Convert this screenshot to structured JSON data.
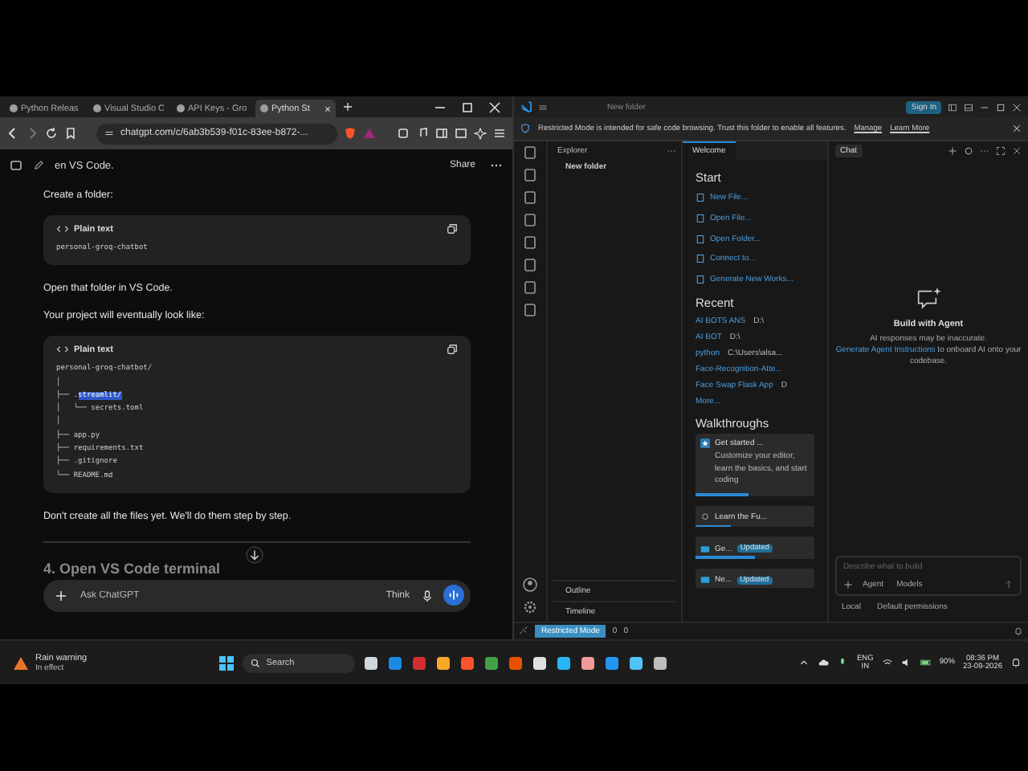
{
  "browser": {
    "tabs": [
      {
        "label": "Python Releas",
        "selected": false
      },
      {
        "label": "Visual Studio C",
        "selected": false
      },
      {
        "label": "API Keys - Gro",
        "selected": false
      },
      {
        "label": "Python St",
        "selected": true
      }
    ],
    "url": "chatgpt.com/c/6ab3b539-f01c-83ee-b872-...",
    "chat": {
      "top_text": "en VS Code.",
      "share": "Share",
      "paragraphs_a": [
        "Create a folder:"
      ],
      "code_blocks": [
        {
          "language": "Plain text",
          "lines": [
            [
              {
                "text": "personal-groq-chatbot",
                "selected": false
              }
            ]
          ]
        },
        {
          "language": "Plain text",
          "lines": [
            [
              {
                "text": "personal-groq-chatbot/",
                "selected": false
              }
            ],
            [
              {
                "text": "│",
                "selected": false
              }
            ],
            [
              {
                "text": "├── .",
                "selected": false
              },
              {
                "text": "streamlit/",
                "selected": true
              }
            ],
            [
              {
                "text": "│   └── secrets.toml",
                "selected": false
              }
            ],
            [
              {
                "text": "│",
                "selected": false
              }
            ],
            [
              {
                "text": "├── app.py",
                "selected": false
              }
            ],
            [
              {
                "text": "├── requirements.txt",
                "selected": false
              }
            ],
            [
              {
                "text": "├── .gitignore",
                "selected": false
              }
            ],
            [
              {
                "text": "└── README.md",
                "selected": false
              }
            ]
          ]
        }
      ],
      "paragraphs_b": [
        "Open that folder in VS Code.",
        "Your project will eventually look like:"
      ],
      "paragraph_c": "Don't create all the files yet. We'll do them step by step.",
      "heading": "4. Open VS Code terminal",
      "input_placeholder": "Ask ChatGPT",
      "think": "Think"
    }
  },
  "vscode": {
    "title": "New folder",
    "sign_in": "Sign In",
    "banner": {
      "text": "Restricted Mode is intended for safe code browsing. Trust this folder to enable all features.",
      "links": [
        "Manage",
        "Learn More"
      ]
    },
    "explorer": {
      "title": "Explorer",
      "folder": "New folder",
      "sections": [
        "Outline",
        "Timeline"
      ]
    },
    "welcome": {
      "tab": "Welcome",
      "start_title": "Start",
      "start": [
        "New File...",
        "Open File...",
        "Open Folder...",
        "Connect to...",
        "Generate New Works..."
      ],
      "recent_title": "Recent",
      "recent": [
        {
          "name": "AI BOTS ANS",
          "path": "D:\\"
        },
        {
          "name": "AI BOT",
          "path": "D:\\"
        },
        {
          "name": "python",
          "path": "C:\\Users\\alsa..."
        },
        {
          "name": "Face-Recognition-Atte..."
        },
        {
          "name": "Face Swap Flask App",
          "path": "D"
        }
      ],
      "more": "More...",
      "walkthroughs_title": "Walkthroughs",
      "walkthroughs": [
        {
          "kind": "card",
          "title": "Get started ...",
          "description": "Customize your editor, learn the basics, and start coding",
          "level": 0.45
        },
        {
          "kind": "item",
          "title": "Learn the Fu...",
          "level": 0.3
        },
        {
          "kind": "item",
          "title": "Ge...",
          "badge": "Updated",
          "level": 0.5
        },
        {
          "kind": "item",
          "title": "Ne...",
          "badge": "Updated"
        }
      ]
    },
    "chat": {
      "tab": "Chat",
      "title": "Build with Agent",
      "note": "AI responses may be inaccurate.",
      "link": "Generate Agent Instructions",
      "rest": " to onboard AI onto your codebase.",
      "placeholder": "Describe what to build",
      "mode": "Agent",
      "models": "Models",
      "footer": [
        "Local",
        "Default permissions"
      ]
    },
    "status": {
      "mode": "Restricted Mode",
      "errors": "0",
      "warnings": "0"
    }
  },
  "taskbar": {
    "weather": {
      "title": "Rain warning",
      "subtitle": "In effect"
    },
    "search": "Search",
    "language": [
      "ENG",
      "IN"
    ],
    "battery": "90%",
    "time": "08:36 PM",
    "date": "23-09-2026"
  }
}
